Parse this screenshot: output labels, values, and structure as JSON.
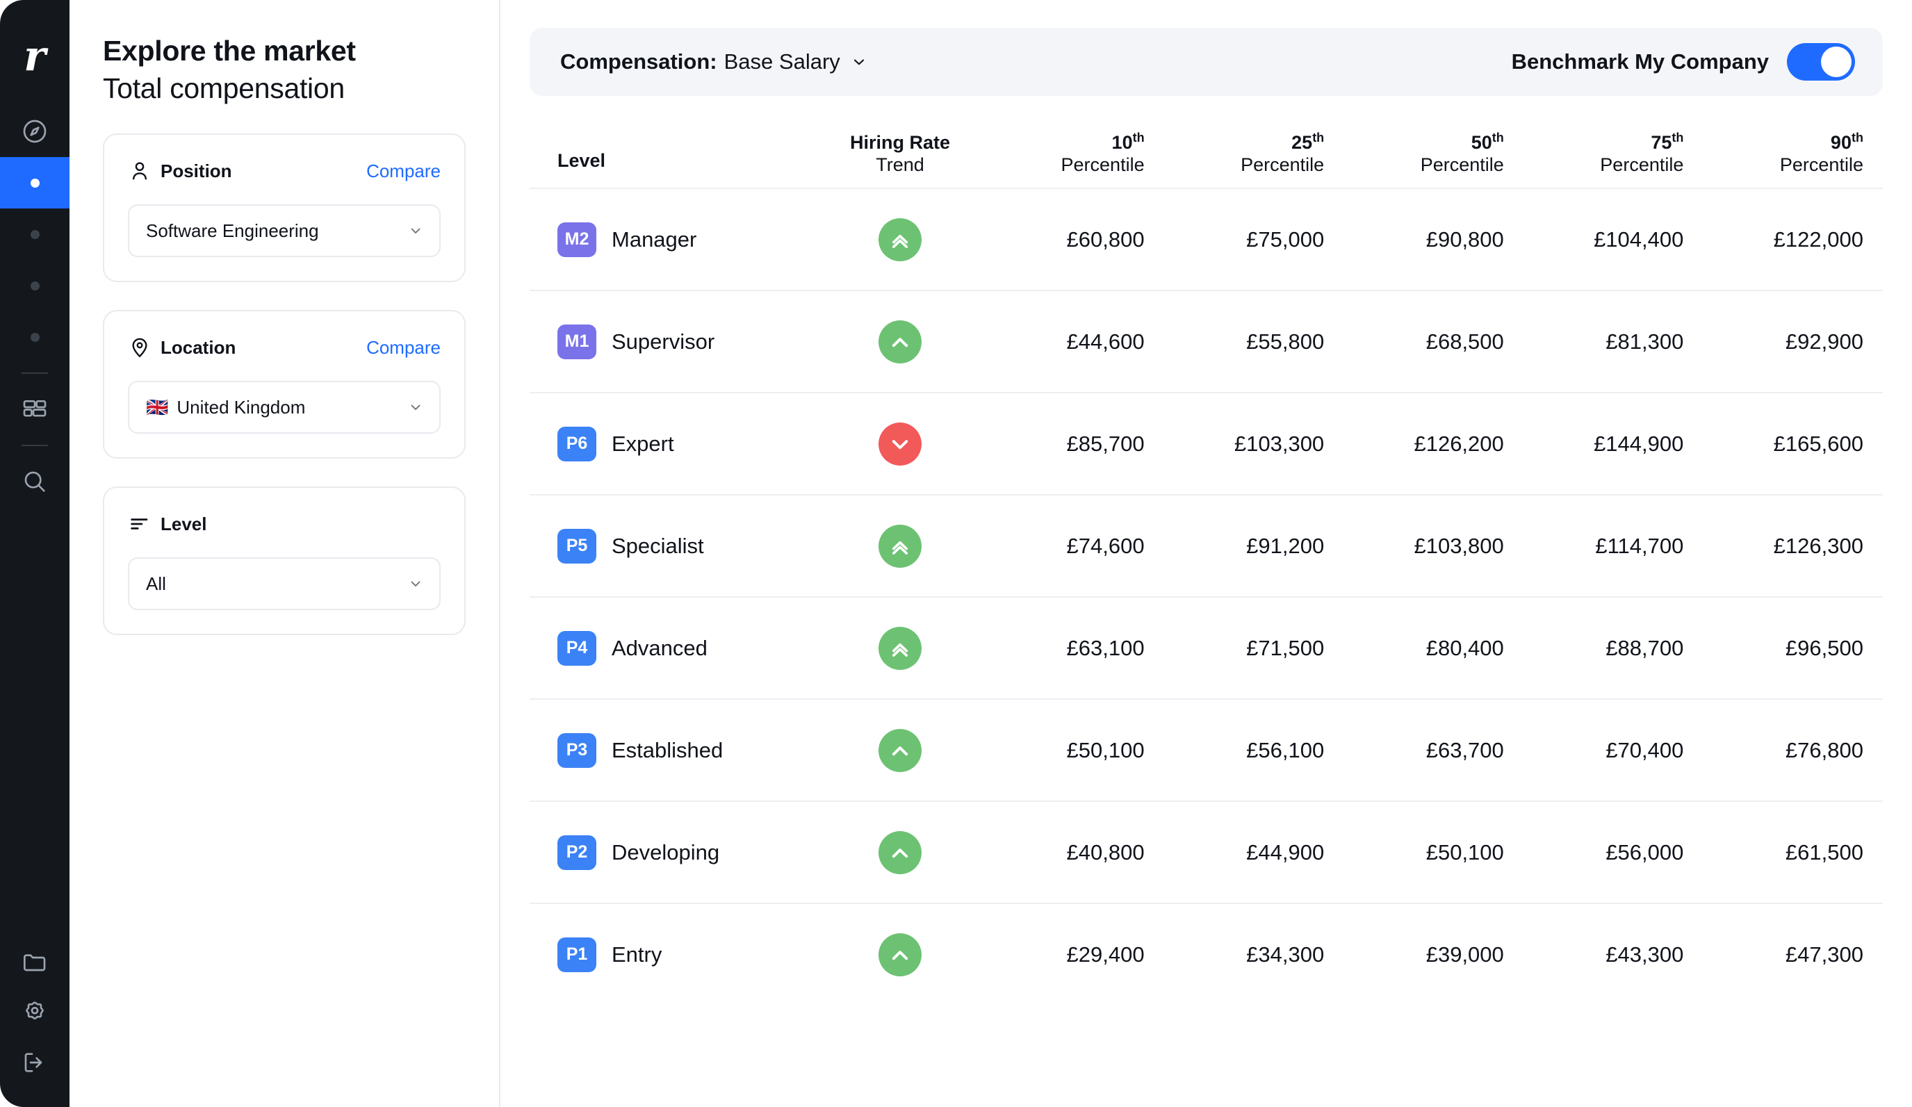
{
  "brand": {
    "logo_letter": "r"
  },
  "rail": {
    "items": [
      {
        "name": "compass-icon",
        "type": "icon",
        "icon": "compass",
        "active": false
      },
      {
        "name": "nav-dot-active",
        "type": "dot",
        "active": true
      },
      {
        "name": "nav-dot-2",
        "type": "dot",
        "active": false
      },
      {
        "name": "nav-dot-3",
        "type": "dot",
        "active": false
      },
      {
        "name": "nav-dot-4",
        "type": "dot",
        "active": false
      },
      {
        "name": "nav-dot-5",
        "type": "dot",
        "active": false
      }
    ],
    "mid_icons": [
      {
        "name": "layout-grid-icon",
        "icon": "layout"
      },
      {
        "name": "search-icon",
        "icon": "search"
      }
    ],
    "bottom_icons": [
      {
        "name": "folder-icon",
        "icon": "folder"
      },
      {
        "name": "gear-icon",
        "icon": "gear"
      },
      {
        "name": "logout-icon",
        "icon": "logout"
      }
    ]
  },
  "header": {
    "title": "Explore the market",
    "subtitle": "Total compensation"
  },
  "filters": [
    {
      "id": "position",
      "icon": "person-icon",
      "label": "Position",
      "action_label": "Compare",
      "has_action": true,
      "flag": "",
      "value": "Software Engineering"
    },
    {
      "id": "location",
      "icon": "map-pin-icon",
      "label": "Location",
      "action_label": "Compare",
      "has_action": true,
      "flag": "🇬🇧",
      "value": "United Kingdom"
    },
    {
      "id": "level",
      "icon": "filter-lines-icon",
      "label": "Level",
      "action_label": "",
      "has_action": false,
      "flag": "",
      "value": "All"
    }
  ],
  "toolbar": {
    "compensation_label": "Compensation:",
    "compensation_value": "Base Salary",
    "benchmark_label": "Benchmark My Company",
    "benchmark_on": true
  },
  "colors": {
    "accent_blue": "#1f6bff",
    "badge_blue": "#3b82f6",
    "badge_purple": "#7a72e8",
    "trend_up": "#6cc272",
    "trend_down": "#f25a5a",
    "rail_bg": "#14181d",
    "bar_bg": "#f3f5f9"
  },
  "table": {
    "columns": [
      {
        "key": "level",
        "label": "Level",
        "sub": ""
      },
      {
        "key": "trend",
        "label": "Hiring Rate",
        "sub": "Trend"
      },
      {
        "key": "p10",
        "label": "10",
        "ord": "th",
        "sub": "Percentile"
      },
      {
        "key": "p25",
        "label": "25",
        "ord": "th",
        "sub": "Percentile"
      },
      {
        "key": "p50",
        "label": "50",
        "ord": "th",
        "sub": "Percentile"
      },
      {
        "key": "p75",
        "label": "75",
        "ord": "th",
        "sub": "Percentile"
      },
      {
        "key": "p90",
        "label": "90",
        "ord": "th",
        "sub": "Percentile"
      }
    ],
    "rows": [
      {
        "code": "M2",
        "code_color": "#7a72e8",
        "name": "Manager",
        "trend": "up-double",
        "trend_color": "#6cc272",
        "p10": "£60,800",
        "p25": "£75,000",
        "p50": "£90,800",
        "p75": "£104,400",
        "p90": "£122,000"
      },
      {
        "code": "M1",
        "code_color": "#7a72e8",
        "name": "Supervisor",
        "trend": "up-single",
        "trend_color": "#6cc272",
        "p10": "£44,600",
        "p25": "£55,800",
        "p50": "£68,500",
        "p75": "£81,300",
        "p90": "£92,900"
      },
      {
        "code": "P6",
        "code_color": "#3b82f6",
        "name": "Expert",
        "trend": "down-single",
        "trend_color": "#f25a5a",
        "p10": "£85,700",
        "p25": "£103,300",
        "p50": "£126,200",
        "p75": "£144,900",
        "p90": "£165,600"
      },
      {
        "code": "P5",
        "code_color": "#3b82f6",
        "name": "Specialist",
        "trend": "up-double",
        "trend_color": "#6cc272",
        "p10": "£74,600",
        "p25": "£91,200",
        "p50": "£103,800",
        "p75": "£114,700",
        "p90": "£126,300"
      },
      {
        "code": "P4",
        "code_color": "#3b82f6",
        "name": "Advanced",
        "trend": "up-double",
        "trend_color": "#6cc272",
        "p10": "£63,100",
        "p25": "£71,500",
        "p50": "£80,400",
        "p75": "£88,700",
        "p90": "£96,500"
      },
      {
        "code": "P3",
        "code_color": "#3b82f6",
        "name": "Established",
        "trend": "up-single",
        "trend_color": "#6cc272",
        "p10": "£50,100",
        "p25": "£56,100",
        "p50": "£63,700",
        "p75": "£70,400",
        "p90": "£76,800"
      },
      {
        "code": "P2",
        "code_color": "#3b82f6",
        "name": "Developing",
        "trend": "up-single",
        "trend_color": "#6cc272",
        "p10": "£40,800",
        "p25": "£44,900",
        "p50": "£50,100",
        "p75": "£56,000",
        "p90": "£61,500"
      },
      {
        "code": "P1",
        "code_color": "#3b82f6",
        "name": "Entry",
        "trend": "up-single",
        "trend_color": "#6cc272",
        "p10": "£29,400",
        "p25": "£34,300",
        "p50": "£39,000",
        "p75": "£43,300",
        "p90": "£47,300"
      }
    ]
  }
}
